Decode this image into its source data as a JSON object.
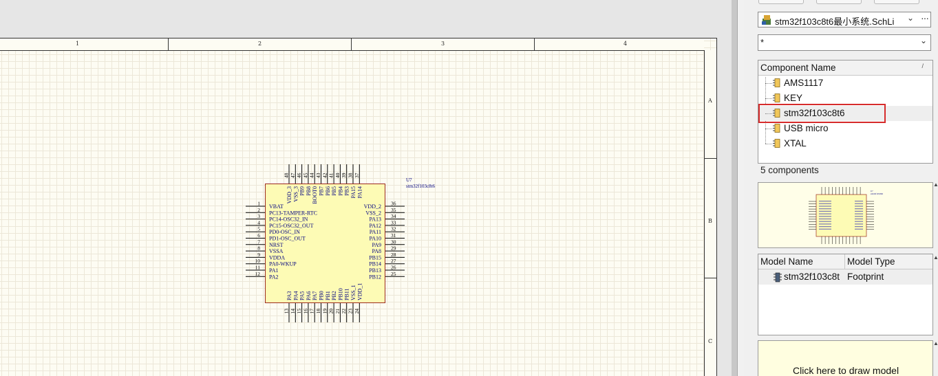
{
  "sheet": {
    "zones_top": [
      "1",
      "2",
      "3",
      "4"
    ],
    "zones_right": [
      "A",
      "B",
      "C"
    ]
  },
  "component": {
    "designator": "U7",
    "comment": "stm32f103c8t6",
    "left_pins": [
      {
        "num": "1",
        "name": "VBAT"
      },
      {
        "num": "2",
        "name": "PC13-TAMPER-RTC"
      },
      {
        "num": "3",
        "name": "PC14-OSC32_IN"
      },
      {
        "num": "4",
        "name": "PC15-OSC32_OUT"
      },
      {
        "num": "5",
        "name": "PD0-OSC_IN"
      },
      {
        "num": "6",
        "name": "PD1-OSC_OUT"
      },
      {
        "num": "7",
        "name": "NRST"
      },
      {
        "num": "8",
        "name": "VSSA"
      },
      {
        "num": "9",
        "name": "VDDA"
      },
      {
        "num": "10",
        "name": "PA0-WKUP"
      },
      {
        "num": "11",
        "name": "PA1"
      },
      {
        "num": "12",
        "name": "PA2"
      }
    ],
    "right_pins": [
      {
        "num": "36",
        "name": "VDD_2"
      },
      {
        "num": "35",
        "name": "VSS_2"
      },
      {
        "num": "34",
        "name": "PA13"
      },
      {
        "num": "33",
        "name": "PA12"
      },
      {
        "num": "32",
        "name": "PA11"
      },
      {
        "num": "31",
        "name": "PA10"
      },
      {
        "num": "30",
        "name": "PA9"
      },
      {
        "num": "29",
        "name": "PA8"
      },
      {
        "num": "28",
        "name": "PB15"
      },
      {
        "num": "27",
        "name": "PB14"
      },
      {
        "num": "26",
        "name": "PB13"
      },
      {
        "num": "25",
        "name": "PB12"
      }
    ],
    "top_pins": [
      {
        "num": "48",
        "name": "VDD_3"
      },
      {
        "num": "47",
        "name": "VSS_3"
      },
      {
        "num": "46",
        "name": "PB9"
      },
      {
        "num": "45",
        "name": "PB8"
      },
      {
        "num": "44",
        "name": "BOOT0"
      },
      {
        "num": "43",
        "name": "PB7"
      },
      {
        "num": "42",
        "name": "PB6"
      },
      {
        "num": "41",
        "name": "PB5"
      },
      {
        "num": "40",
        "name": "PB4"
      },
      {
        "num": "39",
        "name": "PB3"
      },
      {
        "num": "38",
        "name": "PA15"
      },
      {
        "num": "37",
        "name": "PA14"
      }
    ],
    "bottom_pins": [
      {
        "num": "13",
        "name": "PA3"
      },
      {
        "num": "14",
        "name": "PA4"
      },
      {
        "num": "15",
        "name": "PA5"
      },
      {
        "num": "16",
        "name": "PA6"
      },
      {
        "num": "17",
        "name": "PA7"
      },
      {
        "num": "18",
        "name": "PB0"
      },
      {
        "num": "19",
        "name": "PB1"
      },
      {
        "num": "20",
        "name": "PB2"
      },
      {
        "num": "21",
        "name": "PB10"
      },
      {
        "num": "22",
        "name": "PB11"
      },
      {
        "num": "23",
        "name": "VSS_1"
      },
      {
        "num": "24",
        "name": "VDD_1"
      }
    ]
  },
  "panel": {
    "library": "stm32f103c8t6最小系统.SchLi",
    "filter": "*",
    "component_header": "Component Name",
    "sort_indicator": "/",
    "components": [
      "AMS1117",
      "KEY",
      "stm32f103c8t6",
      "USB micro",
      "XTAL"
    ],
    "selected_component": "stm32f103c8t6",
    "count_text": "5 components",
    "model_headers": [
      "Model Name",
      "Model Type"
    ],
    "model_name": "stm32f103c8t",
    "model_type": "Footprint",
    "draw_model": "Click here to draw model"
  },
  "colors": {
    "body_fill": "#fdfbb5",
    "body_stroke": "#9c2a1e",
    "text_blue": "#000080",
    "selection_red": "#d62b2b"
  }
}
